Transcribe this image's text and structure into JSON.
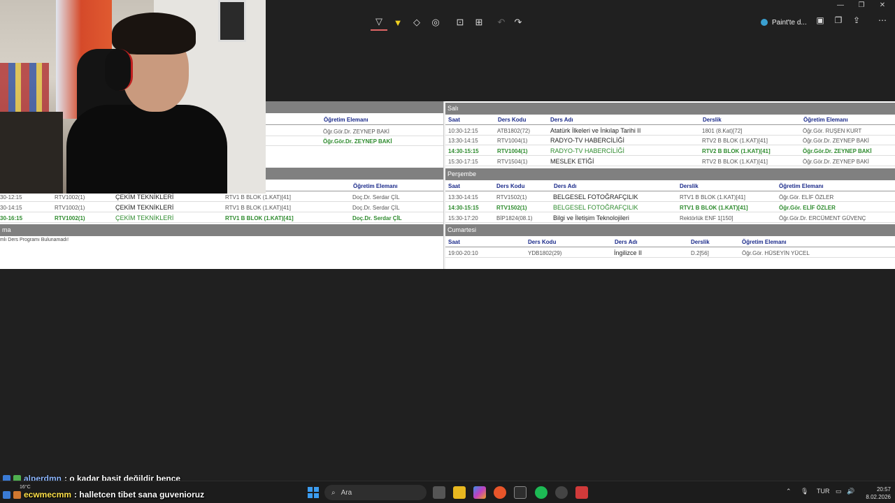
{
  "window": {
    "paint_label": "Paint'te d...",
    "controls": [
      "—",
      "❐",
      "✕"
    ]
  },
  "toolbar": {
    "tools": [
      "pen",
      "highlighter",
      "eraser",
      "shapes",
      "crop",
      "text-detect",
      "undo",
      "redo"
    ]
  },
  "left_table": {
    "top_header": "Öğretim Elemanı",
    "top_rows": [
      {
        "teacher": "Öğr.Gör.Dr. ZEYNEP BAKİ",
        "green": false
      },
      {
        "teacher": "Öğr.Gör.Dr. ZEYNEP BAKİ",
        "green": true
      }
    ],
    "mid_header": "Öğretim Elemanı",
    "mid_rows": [
      {
        "saat": "30-12:15",
        "kod": "RTV1002(1)",
        "ders": "ÇEKİM TEKNİKLERİ",
        "derslik": "RTV1 B BLOK (1.KAT)[41]",
        "hoca": "Doç.Dr. Serdar ÇİL",
        "green": false
      },
      {
        "saat": "30-14:15",
        "kod": "RTV1002(1)",
        "ders": "ÇEKİM TEKNİKLERİ",
        "derslik": "RTV1 B BLOK (1.KAT)[41]",
        "hoca": "Doç.Dr. Serdar ÇİL",
        "green": false
      },
      {
        "saat": "30-16:15",
        "kod": "RTV1002(1)",
        "ders": "ÇEKİM TEKNİKLERİ",
        "derslik": "RTV1 B BLOK (1.KAT)[41]",
        "hoca": "Doç.Dr. Serdar ÇİL",
        "green": true
      }
    ],
    "bottom_day": "ma",
    "bottom_note": "mlı Ders Programı Bulunamadı!"
  },
  "right_table": {
    "salı": {
      "day": "Salı",
      "headers": [
        "Saat",
        "Ders Kodu",
        "Ders Adı",
        "Derslik",
        "Öğretim Elemanı"
      ],
      "rows": [
        {
          "saat": "10:30-12:15",
          "kod": "ATB1802(72)",
          "ders": "Atatürk İlkeleri ve İnkılap Tarihi II",
          "derslik": "1801 (8.Kat)[72]",
          "hoca": "Öğr.Gör. RUŞEN KURT",
          "green": false
        },
        {
          "saat": "13:30-14:15",
          "kod": "RTV1004(1)",
          "ders": "RADYO-TV HABERCİLİĞİ",
          "derslik": "RTV2 B BLOK (1.KAT)[41]",
          "hoca": "Öğr.Gör.Dr. ZEYNEP BAKİ",
          "green": false
        },
        {
          "saat": "14:30-15:15",
          "kod": "RTV1004(1)",
          "ders": "RADYO-TV HABERCİLİĞİ",
          "derslik": "RTV2 B BLOK (1.KAT)[41]",
          "hoca": "Öğr.Gör.Dr. ZEYNEP BAKİ",
          "green": true
        },
        {
          "saat": "15:30-17:15",
          "kod": "RTV1504(1)",
          "ders": "MESLEK ETİĞİ",
          "derslik": "RTV2 B BLOK (1.KAT)[41]",
          "hoca": "Öğr.Gör.Dr. ZEYNEP BAKİ",
          "green": false
        }
      ]
    },
    "persembe": {
      "day": "Perşembe",
      "headers": [
        "Saat",
        "Ders Kodu",
        "Ders Adı",
        "Derslik",
        "Öğretim Elemanı"
      ],
      "rows": [
        {
          "saat": "13:30-14:15",
          "kod": "RTV1502(1)",
          "ders": "BELGESEL FOTOĞRAFÇILIK",
          "derslik": "RTV1 B BLOK (1.KAT)[41]",
          "hoca": "Öğr.Gör. ELİF ÖZLER",
          "green": false
        },
        {
          "saat": "14:30-15:15",
          "kod": "RTV1502(1)",
          "ders": "BELGESEL FOTOĞRAFÇILIK",
          "derslik": "RTV1 B BLOK (1.KAT)[41]",
          "hoca": "Öğr.Gör. ELİF ÖZLER",
          "green": true
        },
        {
          "saat": "15:30-17:20",
          "kod": "BİP1824(08.1)",
          "ders": "Bilgi ve İletişim Teknolojileri",
          "derslik": "Rektörlük ENF 1[150]",
          "hoca": "Öğr.Gör.Dr. ERCÜMENT GÜVENÇ",
          "green": false
        }
      ]
    },
    "cumartesi": {
      "day": "Cumartesi",
      "headers": [
        "Saat",
        "Ders Kodu",
        "Ders Adı",
        "Derslik",
        "Öğretim Elemanı"
      ],
      "rows": [
        {
          "saat": "19:00-20:10",
          "kod": "YDB1802(29)",
          "ders": "İngilizce II",
          "derslik": "D.2[56]",
          "hoca": "Öğr.Gör. HÜSEYİN YÜCEL",
          "green": false
        }
      ]
    }
  },
  "chat": [
    {
      "user": "alperdmn",
      "message": ": o kadar basit değildir bence"
    },
    {
      "user": "ecwmecmm",
      "message": ": halletcen tibet sana guvenioruz"
    }
  ],
  "taskbar": {
    "search_placeholder": "Ara",
    "weather": "16°C",
    "language": "TUR",
    "time": "20:57",
    "date": "8.02.2026"
  },
  "colors": {
    "green_row": "#2e8b2e",
    "header_blue": "#1a2a8a",
    "day_bar": "#808080"
  }
}
